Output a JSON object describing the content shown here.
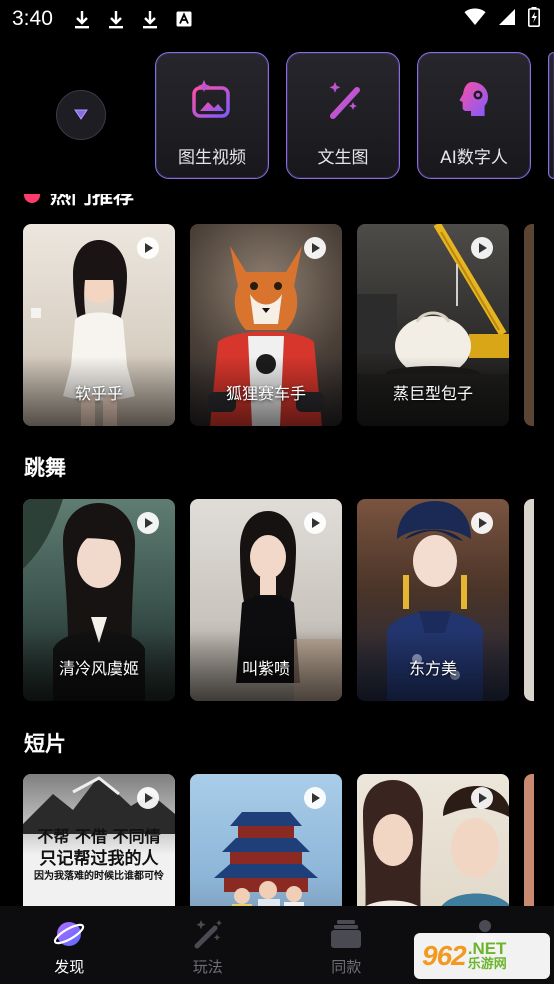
{
  "status_bar": {
    "time": "3:40",
    "left_icons": [
      "download-icon",
      "download-icon",
      "download-icon",
      "a-box-icon"
    ],
    "right_icons": [
      "wifi-icon",
      "signal-icon",
      "battery-icon"
    ]
  },
  "tools": [
    {
      "label": "图生视频",
      "icon": "image-sparkle-icon"
    },
    {
      "label": "文生图",
      "icon": "magic-wand-icon"
    },
    {
      "label": "AI数字人",
      "icon": "ai-head-icon"
    }
  ],
  "sections": [
    {
      "title": "热门推荐",
      "cards": [
        {
          "label": "软乎乎",
          "bg": [
            "#e9e2d8",
            "#c9bfb2"
          ]
        },
        {
          "label": "狐狸赛车手",
          "bg": [
            "#6f5b4c",
            "#2d2b2f"
          ]
        },
        {
          "label": "蒸巨型包子",
          "bg": [
            "#4b4a48",
            "#1e1e1e"
          ]
        }
      ]
    },
    {
      "title": "跳舞",
      "cards": [
        {
          "label": "清冷风虞姬",
          "bg": [
            "#4f6a63",
            "#1f2d2b"
          ]
        },
        {
          "label": "叫紫啧",
          "bg": [
            "#d8d4ce",
            "#8f8a84"
          ]
        },
        {
          "label": "东方美",
          "bg": [
            "#6b4a3a",
            "#1f2946"
          ]
        }
      ]
    },
    {
      "title": "短片",
      "cards": [
        {
          "label": "",
          "bg": [
            "#9a9a9a",
            "#ebebeb"
          ],
          "poster": [
            "不帮 不借 不同情",
            "只记帮过我的人",
            "因为我落难的时候比谁都可怜"
          ]
        },
        {
          "label": "",
          "bg": [
            "#9fc2e0",
            "#5b6f87"
          ]
        },
        {
          "label": "",
          "bg": [
            "#e4ddd0",
            "#a89a88"
          ]
        }
      ]
    }
  ],
  "bottom_nav": [
    {
      "label": "发现",
      "icon": "planet-icon",
      "active": true
    },
    {
      "label": "玩法",
      "icon": "magic-wand-icon",
      "active": false
    },
    {
      "label": "同款",
      "icon": "stack-icon",
      "active": false
    },
    {
      "label": "",
      "icon": "person-icon",
      "active": false
    }
  ],
  "watermark": {
    "number": "962",
    "domain": ".NET",
    "sub": "乐游网"
  },
  "colors": {
    "accent": "#8a6be0",
    "hot": "#ff3b6b"
  }
}
